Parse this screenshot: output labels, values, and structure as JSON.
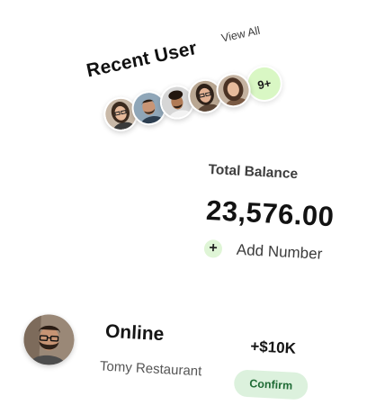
{
  "recent_users": {
    "title": "Recent User",
    "view_all_label": "View All",
    "avatars": [
      "avatar-woman-glasses",
      "avatar-man-beard",
      "avatar-man-curly",
      "avatar-woman-smiling",
      "avatar-woman-long-hair"
    ],
    "more_badge": "9+",
    "colors": {
      "badge_bg": "#d9f7c4"
    }
  },
  "balance": {
    "label": "Total Balance",
    "amount": "23,576.00",
    "add_icon": "+",
    "add_label": "Add Number",
    "colors": {
      "add_icon_bg": "#dff5d6"
    }
  },
  "transaction": {
    "avatar": "avatar-man-glasses-beard",
    "title": "Online",
    "subtitle": "Tomy Restaurant",
    "amount": "+$10K",
    "confirm_label": "Confirm",
    "colors": {
      "confirm_bg": "#dcf1dd",
      "confirm_text": "#1f6b35"
    }
  }
}
